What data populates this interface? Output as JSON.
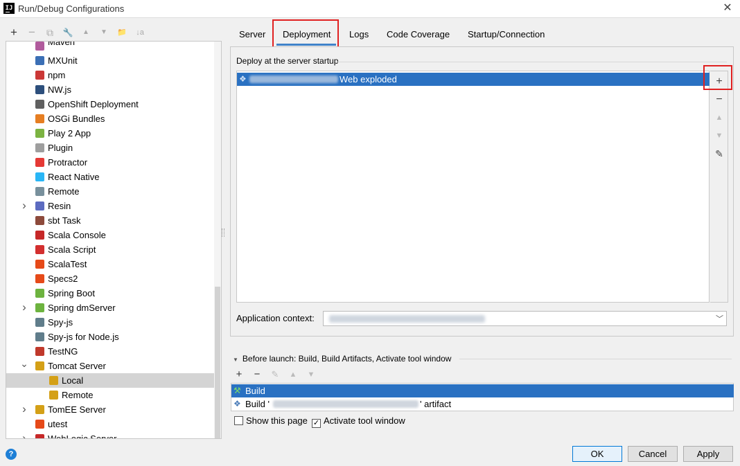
{
  "window": {
    "title": "Run/Debug Configurations",
    "app_badge": "IJ"
  },
  "left_toolbar": [
    "+",
    "−",
    "⧉",
    "🔧",
    "▲",
    "▼",
    "📁",
    "↓a"
  ],
  "tree": [
    {
      "label": "Maven",
      "indent": 1,
      "icon_color": "#b05a9c",
      "partial": true
    },
    {
      "label": "MXUnit",
      "indent": 1,
      "icon_color": "#3b6fb5"
    },
    {
      "label": "npm",
      "indent": 1,
      "icon_color": "#cb3837"
    },
    {
      "label": "NW.js",
      "indent": 1,
      "icon_color": "#2d4f7c"
    },
    {
      "label": "OpenShift Deployment",
      "indent": 1,
      "icon_color": "#606060"
    },
    {
      "label": "OSGi Bundles",
      "indent": 1,
      "icon_color": "#e67e22"
    },
    {
      "label": "Play 2 App",
      "indent": 1,
      "icon_color": "#7cb342"
    },
    {
      "label": "Plugin",
      "indent": 1,
      "icon_color": "#9e9e9e"
    },
    {
      "label": "Protractor",
      "indent": 1,
      "icon_color": "#e53935"
    },
    {
      "label": "React Native",
      "indent": 1,
      "icon_color": "#29b6f6"
    },
    {
      "label": "Remote",
      "indent": 1,
      "icon_color": "#78909c"
    },
    {
      "label": "Resin",
      "indent": 1,
      "icon_color": "#5c6bc0",
      "expandable": true
    },
    {
      "label": "sbt Task",
      "indent": 1,
      "icon_color": "#8d4a3b"
    },
    {
      "label": "Scala Console",
      "indent": 1,
      "icon_color": "#c62828"
    },
    {
      "label": "Scala Script",
      "indent": 1,
      "icon_color": "#d32f2f"
    },
    {
      "label": "ScalaTest",
      "indent": 1,
      "icon_color": "#e64a19"
    },
    {
      "label": "Specs2",
      "indent": 1,
      "icon_color": "#e64a19"
    },
    {
      "label": "Spring Boot",
      "indent": 1,
      "icon_color": "#6db33f"
    },
    {
      "label": "Spring dmServer",
      "indent": 1,
      "icon_color": "#6db33f",
      "expandable": true
    },
    {
      "label": "Spy-js",
      "indent": 1,
      "icon_color": "#607d8b"
    },
    {
      "label": "Spy-js for Node.js",
      "indent": 1,
      "icon_color": "#607d8b"
    },
    {
      "label": "TestNG",
      "indent": 1,
      "icon_color": "#c0392b"
    },
    {
      "label": "Tomcat Server",
      "indent": 1,
      "icon_color": "#d4a017",
      "expanded": true
    },
    {
      "label": "Local",
      "indent": 2,
      "icon_color": "#d4a017",
      "selected": true
    },
    {
      "label": "Remote",
      "indent": 2,
      "icon_color": "#d4a017"
    },
    {
      "label": "TomEE Server",
      "indent": 1,
      "icon_color": "#d4a017",
      "expandable": true
    },
    {
      "label": "utest",
      "indent": 1,
      "icon_color": "#e64a19"
    },
    {
      "label": "WebLogic Server",
      "indent": 1,
      "icon_color": "#c62828",
      "expandable": true
    }
  ],
  "tabs": [
    {
      "label": "Server"
    },
    {
      "label": "Deployment",
      "active": true
    },
    {
      "label": "Logs"
    },
    {
      "label": "Code Coverage"
    },
    {
      "label": "Startup/Connection"
    }
  ],
  "deployment": {
    "section_title": "Deploy at the server startup",
    "items": [
      {
        "label": "Web exploded"
      }
    ],
    "side_buttons": {
      "add": "+",
      "remove": "−",
      "up": "▲",
      "down": "▼",
      "edit": "✎"
    },
    "app_context_label": "Application context:"
  },
  "before_launch": {
    "header": "Before launch: Build, Build Artifacts, Activate tool window",
    "toolbar": {
      "add": "+",
      "remove": "−",
      "edit": "✎",
      "up": "▲",
      "down": "▼"
    },
    "items": [
      {
        "label": "Build",
        "selected": true
      },
      {
        "prefix": "Build '",
        "suffix": "' artifact"
      }
    ]
  },
  "options": {
    "show_this_page": {
      "label": "Show this page",
      "checked": false
    },
    "activate_tool_window": {
      "label": "Activate tool window",
      "checked": true
    }
  },
  "buttons": {
    "ok": "OK",
    "cancel": "Cancel",
    "apply": "Apply"
  },
  "colors": {
    "selection": "#2a71c2",
    "highlight_box": "#e02020",
    "tab_underline": "#4083c9"
  }
}
